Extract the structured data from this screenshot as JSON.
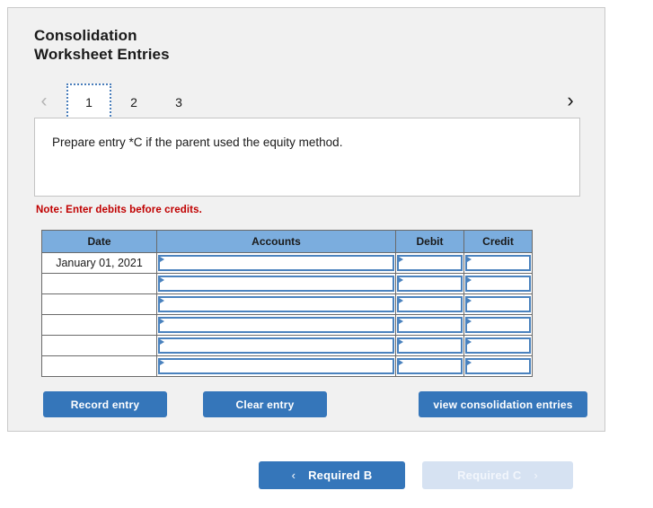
{
  "card": {
    "title_line1": "Consolidation",
    "title_line2": "Worksheet Entries"
  },
  "pagination": {
    "prev_icon": "chevron-left-icon",
    "next_icon": "chevron-right-icon",
    "prev_glyph": "‹",
    "next_glyph": "›",
    "pages": [
      {
        "label": "1",
        "active": true
      },
      {
        "label": "2",
        "active": false
      },
      {
        "label": "3",
        "active": false
      }
    ]
  },
  "instruction": {
    "text": "Prepare entry *C if the parent used the equity method."
  },
  "note": {
    "text": "Note: Enter debits before credits."
  },
  "journal": {
    "columns": [
      "Date",
      "Accounts",
      "Debit",
      "Credit"
    ],
    "rows": [
      {
        "date": "January 01, 2021",
        "accounts": "",
        "debit": "",
        "credit": ""
      },
      {
        "date": "",
        "accounts": "",
        "debit": "",
        "credit": ""
      },
      {
        "date": "",
        "accounts": "",
        "debit": "",
        "credit": ""
      },
      {
        "date": "",
        "accounts": "",
        "debit": "",
        "credit": ""
      },
      {
        "date": "",
        "accounts": "",
        "debit": "",
        "credit": ""
      },
      {
        "date": "",
        "accounts": "",
        "debit": "",
        "credit": ""
      }
    ]
  },
  "actions": {
    "record_label": "Record entry",
    "clear_label": "Clear entry",
    "view_label": "view consolidation entries"
  },
  "bottom_nav": {
    "prev_label": "Required B",
    "prev_chevron": "‹",
    "next_label": "Required C",
    "next_chevron": "›"
  },
  "colors": {
    "accent_blue": "#3576ba",
    "header_blue": "#7badde",
    "input_border_blue": "#4a82be",
    "disabled_blue": "#d6e2f2",
    "note_red": "#c00000",
    "card_bg": "#f1f1f1"
  }
}
